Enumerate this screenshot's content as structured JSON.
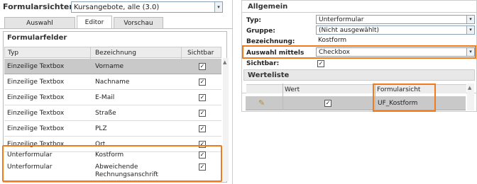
{
  "header": {
    "label": "Formularsichten:",
    "select_value": "Kursangebote, alle (3.0)"
  },
  "tabs": [
    {
      "label": "Auswahl"
    },
    {
      "label": "Editor"
    },
    {
      "label": "Vorschau"
    }
  ],
  "fields_panel": {
    "title": "Formularfelder",
    "columns": [
      "Typ",
      "Bezeichnung",
      "Sichtbar"
    ],
    "rows": [
      {
        "typ": "Einzeilige Textbox",
        "bez": "Vorname",
        "bez2": "",
        "sichtbar": "✓"
      },
      {
        "typ": "Einzeilige Textbox",
        "bez": "Nachname",
        "bez2": "",
        "sichtbar": "✓"
      },
      {
        "typ": "Einzeilige Textbox",
        "bez": "E-Mail",
        "bez2": "",
        "sichtbar": "✓"
      },
      {
        "typ": "Einzeilige Textbox",
        "bez": "Straße",
        "bez2": "",
        "sichtbar": "✓"
      },
      {
        "typ": "Einzeilige Textbox",
        "bez": "PLZ",
        "bez2": "",
        "sichtbar": "✓"
      },
      {
        "typ": "Einzeilige Textbox",
        "bez": "Ort",
        "bez2": "",
        "sichtbar": "✓"
      },
      {
        "typ": "Unterformular",
        "bez": "Kostform",
        "bez2": "",
        "sichtbar": "✓"
      },
      {
        "typ": "Unterformular",
        "bez": "Abweichende",
        "bez2": "Rechnungsanschrift",
        "sichtbar": "✓"
      }
    ]
  },
  "general": {
    "title": "Allgemein",
    "typ_label": "Typ:",
    "typ_value": "Unterformular",
    "gruppe_label": "Gruppe:",
    "gruppe_value": "(Nicht ausgewählt)",
    "bez_label": "Bezeichnung:",
    "bez_value": "Kostform",
    "auswahl_label": "Auswahl mittels",
    "auswahl_value": "Checkbox",
    "sichtbar_label": "Sichtbar:",
    "sichtbar_check": "✓"
  },
  "values_list": {
    "title": "Werteliste",
    "columns": [
      "Wert",
      "Formularsicht"
    ],
    "rows": [
      {
        "wert_check": "✓",
        "formularsicht": "UF_Kostform"
      }
    ]
  },
  "colors": {
    "highlight": "#f07a1e",
    "selected_row": "#c9c9c9",
    "header_bg": "#e6e6e6"
  }
}
